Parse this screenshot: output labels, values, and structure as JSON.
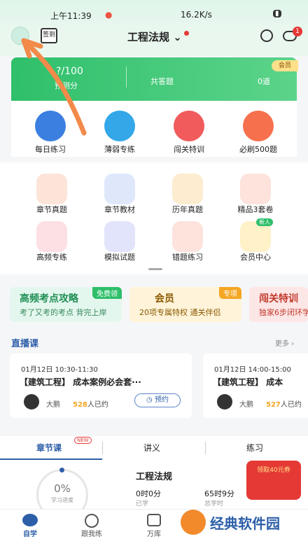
{
  "status": {
    "time": "上午11:39",
    "speed": "16.2K/s"
  },
  "header": {
    "checkin_label": "签到",
    "title": "工程法规",
    "search_icon": "search-icon",
    "msg_badge": "1"
  },
  "summary": {
    "score": "?/100",
    "score_label": "预测分",
    "total_label": "共答题",
    "total_value": "0道",
    "vip_label": "会员"
  },
  "quick_actions": [
    {
      "label": "每日练习",
      "icon": "clock-icon"
    },
    {
      "label": "薄弱专练",
      "icon": "chat-icon"
    },
    {
      "label": "闯关特训",
      "icon": "target-icon"
    },
    {
      "label": "必刷500题",
      "icon": "500-icon"
    }
  ],
  "grid": [
    {
      "label": "章节真题"
    },
    {
      "label": "章节教材"
    },
    {
      "label": "历年真题"
    },
    {
      "label": "精品3套卷"
    },
    {
      "label": "高频专练"
    },
    {
      "label": "模拟试题"
    },
    {
      "label": "错题练习"
    },
    {
      "label": "会员中心",
      "badge": "新人"
    }
  ],
  "promos": [
    {
      "title": "高频考点攻略",
      "sub": "考了又考的考点 背完上岸",
      "tag": "免费领"
    },
    {
      "title": "会员",
      "sub": "20项专属特权  通关伴侣",
      "tag": "专项"
    },
    {
      "title": "闯关特训",
      "sub": "独家6步闭环学"
    }
  ],
  "live": {
    "header": "直播课",
    "more": "更多",
    "cards": [
      {
        "time": "01月12日  10:30-11:30",
        "title": "【建筑工程】 成本案例必会套···",
        "teacher": "大鹏",
        "count": "528",
        "count_suffix": "人已约",
        "button": "预约"
      },
      {
        "time": "01月12日  14:00-15:00",
        "title": "【建筑工程】 成本",
        "teacher": "大鹏",
        "count": "527",
        "count_suffix": "人已约"
      }
    ]
  },
  "tabs": {
    "t1": "章节课",
    "t2": "讲义",
    "t3": "练习",
    "new_badge": "NEW"
  },
  "progress": {
    "pct": "0%",
    "pct_label": "学习进度",
    "subject": "工程法规",
    "studied": "0时0分",
    "studied_label": "已学",
    "total": "65时9分",
    "total_label": "总学时",
    "gift": "领取40元券"
  },
  "nav": {
    "n1": "自学",
    "n2": "跟我练",
    "n3": "万库"
  },
  "watermark": "经典软件园"
}
